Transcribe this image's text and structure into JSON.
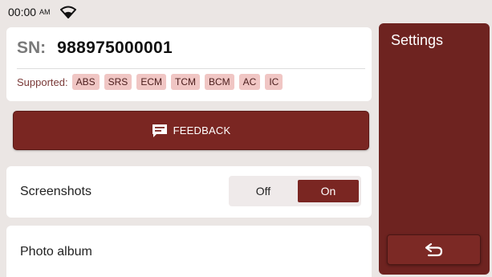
{
  "status_bar": {
    "time": "00:00",
    "ampm": "AM",
    "wifi_icon": "wifi-icon"
  },
  "device": {
    "sn_label": "SN:",
    "sn_value": "988975000001",
    "supported_label": "Supported:",
    "supported_systems": [
      "ABS",
      "SRS",
      "ECM",
      "TCM",
      "BCM",
      "AC",
      "IC"
    ]
  },
  "feedback": {
    "icon": "message-icon",
    "label": "FEEDBACK"
  },
  "screenshots": {
    "label": "Screenshots",
    "off_label": "Off",
    "on_label": "On",
    "selected": "On"
  },
  "photo_album": {
    "label": "Photo album"
  },
  "side_panel": {
    "title": "Settings",
    "back_icon": "return-arrow-icon"
  },
  "colors": {
    "accent": "#7a2622",
    "panel": "#6e2320",
    "tag_bg": "#f0c6c4",
    "background": "#ebe6e4"
  }
}
